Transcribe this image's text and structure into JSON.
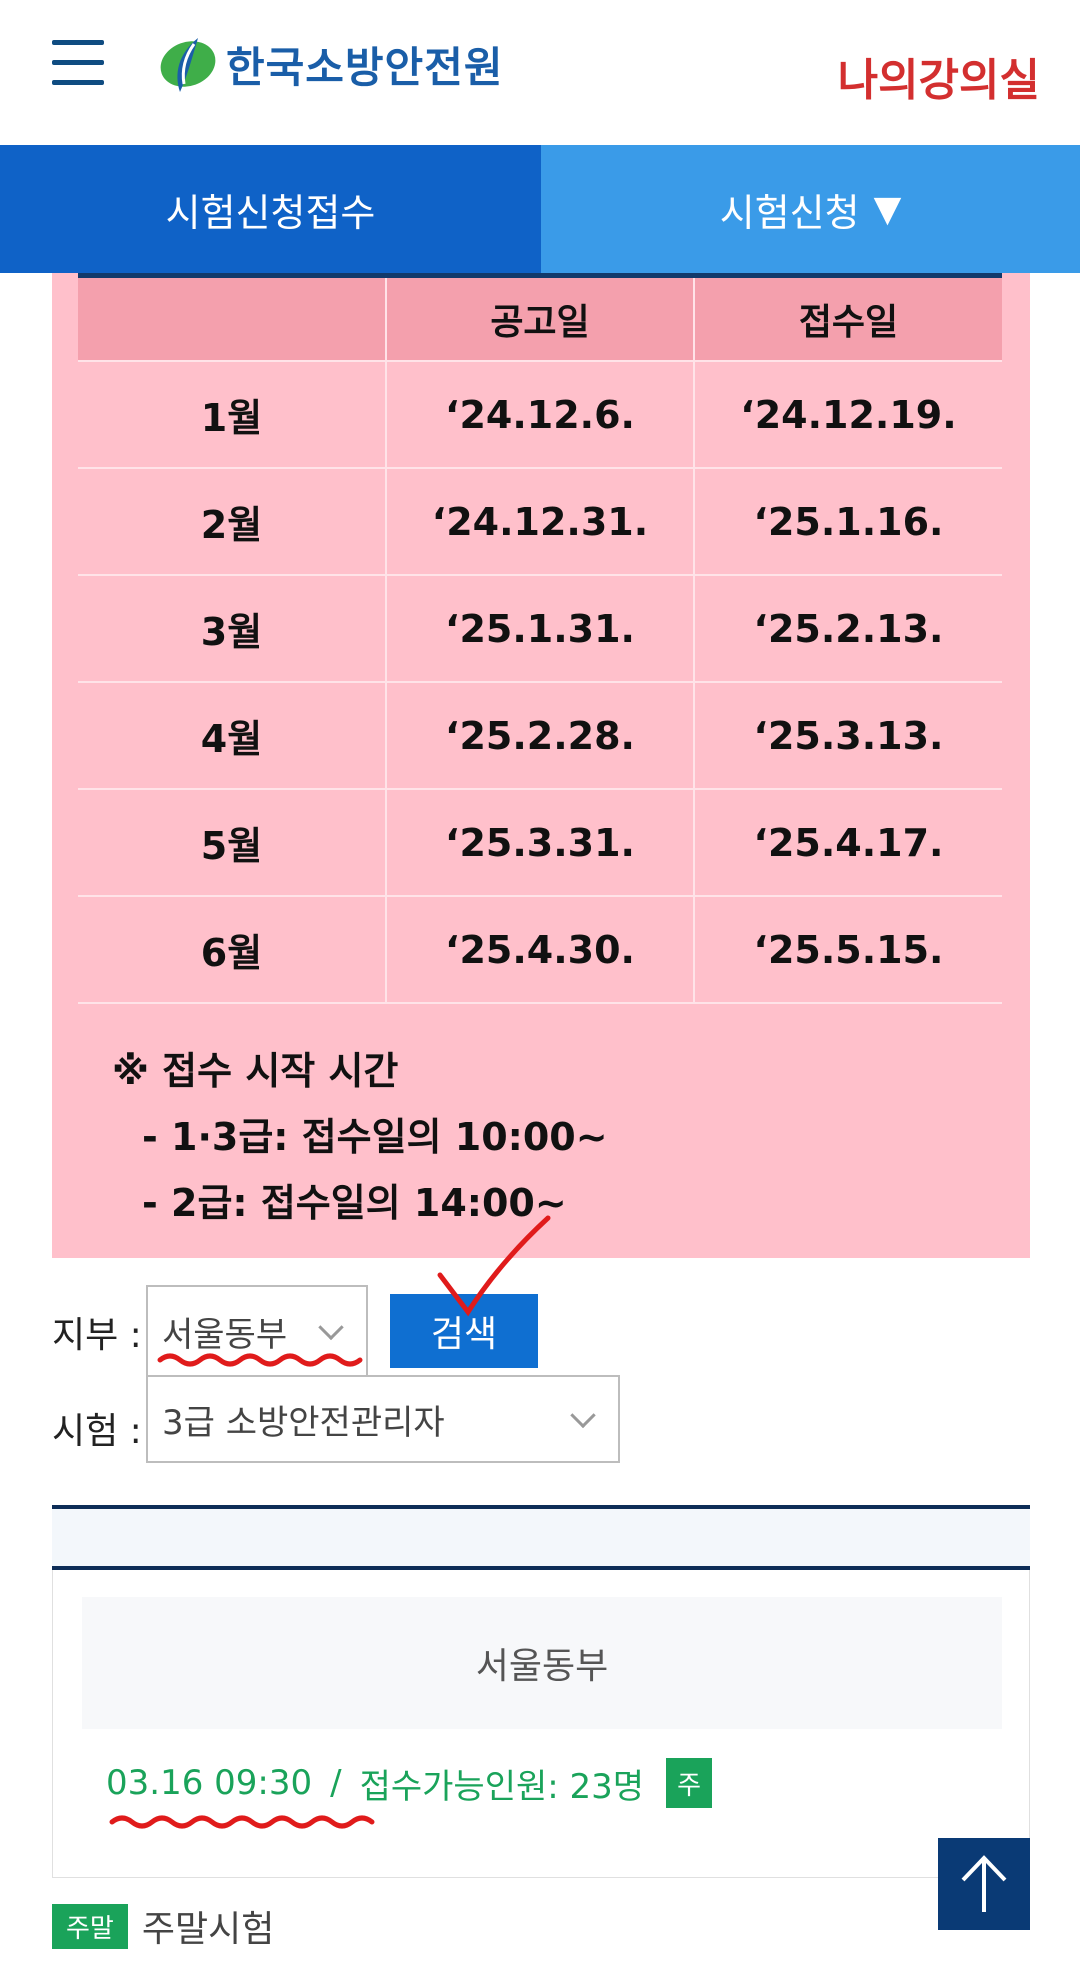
{
  "header": {
    "logo_text": "한국소방안전원",
    "my_lecture": "나의강의실",
    "brand_color": "#1a5ea8",
    "accent_color": "#d32f2f"
  },
  "tabs": {
    "left_label": "시험신청접수",
    "right_label": "시험신청",
    "right_icon": "triangle-down-icon"
  },
  "schedule": {
    "headers": [
      "",
      "공고일",
      "접수일"
    ],
    "rows": [
      [
        "1월",
        "‘24.12.6.",
        "‘24.12.19."
      ],
      [
        "2월",
        "‘24.12.31.",
        "‘25.1.16."
      ],
      [
        "3월",
        "‘25.1.31.",
        "‘25.2.13."
      ],
      [
        "4월",
        "‘25.2.28.",
        "‘25.3.13."
      ],
      [
        "5월",
        "‘25.3.31.",
        "‘25.4.17."
      ],
      [
        "6월",
        "‘25.4.30.",
        "‘25.5.15."
      ]
    ],
    "note_title": "※ 접수 시작 시간",
    "note_line1": "- 1·3급: 접수일의 10:00~",
    "note_line2": "- 2급: 접수일의 14:00~",
    "background": "#ffc0cb"
  },
  "filters": {
    "branch_label": "지부 :",
    "branch_value": "서울동부",
    "search_label": "검색",
    "exam_label": "시험 :",
    "exam_value": "3급 소방안전관리자"
  },
  "results": {
    "branch_name": "서울동부",
    "slot_datetime": "03.16 09:30",
    "slot_separator": "/",
    "slot_capacity": "접수가능인원: 23명",
    "slot_badge": "주",
    "legend_tag": "주말",
    "legend_text": "주말시험",
    "status_color": "#1aa35a"
  },
  "scroll_top_icon": "arrow-up-icon"
}
